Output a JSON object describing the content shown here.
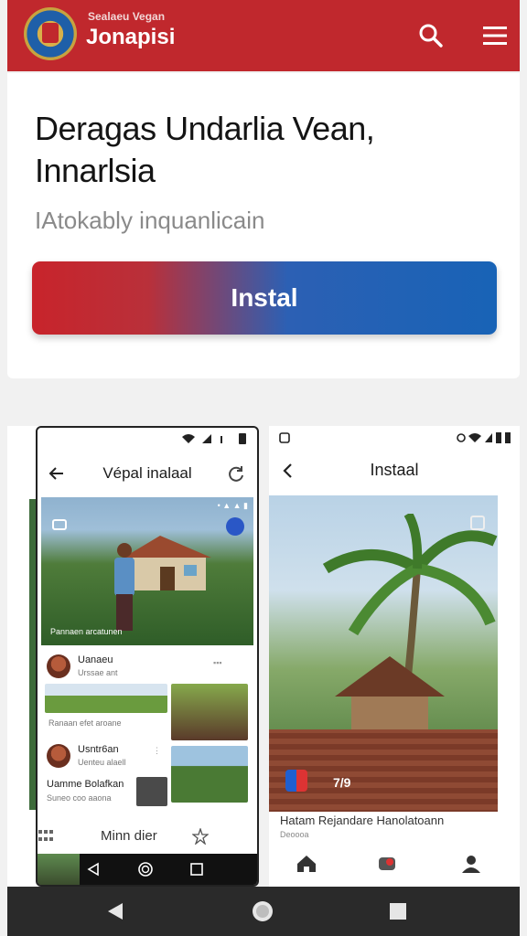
{
  "header": {
    "app_subtitle": "Sealaeu Vegan",
    "app_title": "Jonapisi",
    "search_icon": "search-icon",
    "menu_icon": "hamburger-menu-icon",
    "colors": {
      "brand": "#c0282d"
    }
  },
  "hero": {
    "title": "Deragas Undarlia Vean, Innarlsia",
    "subtitle": "IAtokably inquanlicain",
    "install_label": "Instal",
    "colors": {
      "gradient_start": "#c8242b",
      "gradient_end": "#1863b6"
    }
  },
  "screenshots": {
    "phone": {
      "title": "Vépal inalaal",
      "hero_caption": "Pannaen arcatunen",
      "feed": [
        {
          "user": "Uanaeu",
          "meta": "Urssae ant"
        },
        {
          "user": "Usntr6an",
          "meta": "Uenteu alaell"
        }
      ],
      "mid_caption": "Ranaan efet aroane",
      "name_line": "Uamme Bolafkan",
      "name_meta": "Suneo coo aaona",
      "tab_label": "Minn dier"
    },
    "right": {
      "title": "Instaal",
      "photo_number": "7/9",
      "caption": "Hatam Rejandare Hanolatoann",
      "caption_sub": "Deoooa"
    }
  }
}
